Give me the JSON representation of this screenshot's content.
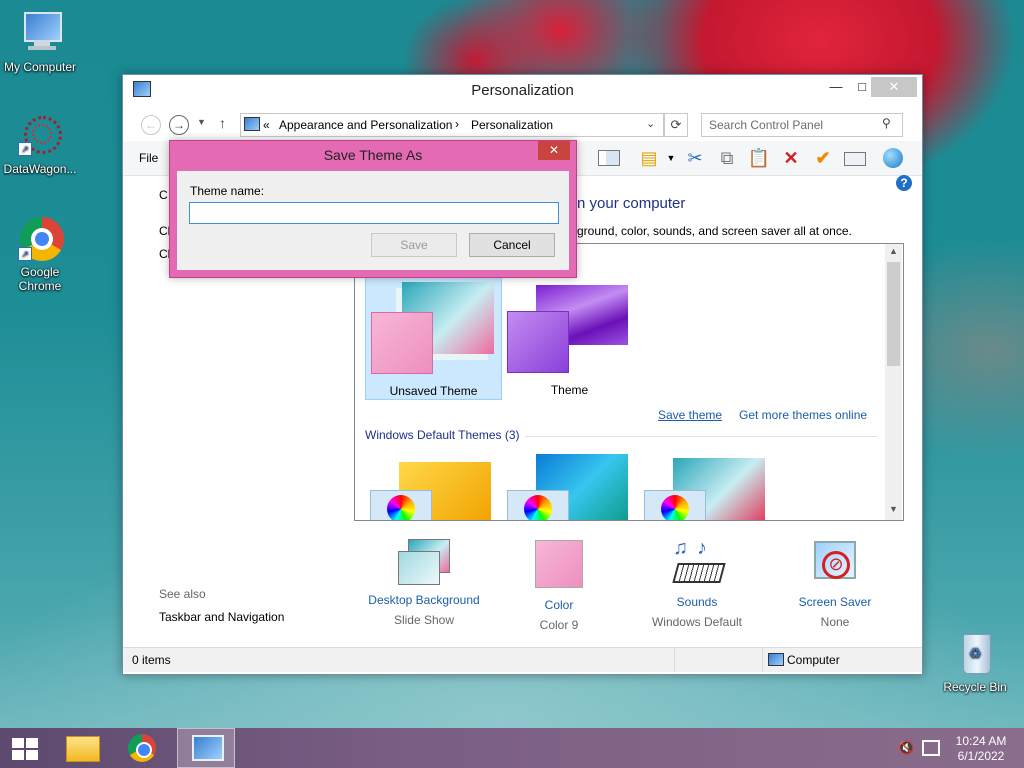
{
  "desktop": {
    "icons": [
      {
        "label": "My Computer"
      },
      {
        "label": "DataWagon..."
      },
      {
        "label": "Google Chrome"
      },
      {
        "label": "Recycle Bin"
      }
    ]
  },
  "window": {
    "title": "Personalization",
    "address": {
      "prefix": "«",
      "crumb1": "Appearance and Personalization",
      "sep": "›",
      "crumb2": "Personalization"
    },
    "search_placeholder": "Search Control Panel",
    "menu_file": "File",
    "left_partial": [
      "C",
      "Cl",
      "Cl"
    ],
    "heading_partial": "n your computer",
    "subheading_partial": "ground, color, sounds, and screen saver all at once.",
    "my_themes": [
      {
        "label": "Unsaved Theme",
        "selected": true
      },
      {
        "label": "Theme",
        "selected": false
      }
    ],
    "save_theme_link": "Save theme",
    "get_more_link": "Get more themes online",
    "default_themes_header": "Windows Default Themes (3)",
    "see_also": "See also",
    "taskbar_nav_link": "Taskbar and Navigation",
    "settings": [
      {
        "title": "Desktop Background",
        "value": "Slide Show"
      },
      {
        "title": "Color",
        "value": "Color 9"
      },
      {
        "title": "Sounds",
        "value": "Windows Default"
      },
      {
        "title": "Screen Saver",
        "value": "None"
      }
    ],
    "status_items": "0 items",
    "status_location": "Computer"
  },
  "dialog": {
    "title": "Save Theme As",
    "field_label": "Theme name:",
    "field_value": "",
    "save_label": "Save",
    "cancel_label": "Cancel"
  },
  "taskbar": {
    "time": "10:24 AM",
    "date": "6/1/2022"
  },
  "colors": {
    "accent": "#e36ab3",
    "link": "#1a5ea8",
    "selection": "#cce8ff"
  }
}
